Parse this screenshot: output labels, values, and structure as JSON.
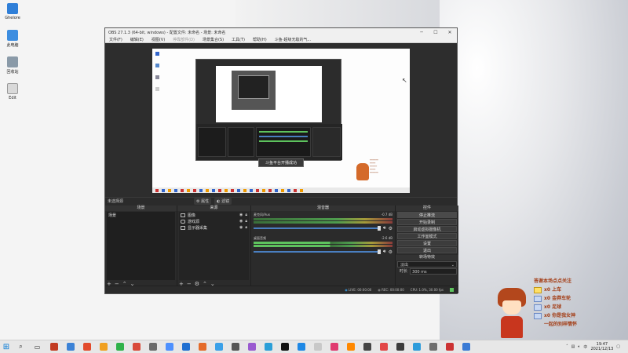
{
  "desktop": {
    "icons": [
      {
        "label": "Ghelore",
        "color": "#2f7fd8",
        "icon": "folder-icon"
      },
      {
        "label": "此电脑",
        "color": "#3c8de0",
        "icon": "computer-icon"
      },
      {
        "label": "回收站",
        "color": "#8a9aa8",
        "icon": "recycle-bin-icon"
      },
      {
        "label": "Edit",
        "color": "#d9d9d9",
        "icon": "file-icon"
      }
    ]
  },
  "obs": {
    "title": "OBS 27.1.3 (64-bit, windows) - 配置文件: 未命名 - 场景: 未命名",
    "menu": [
      "文件(F)",
      "编辑(E)",
      "视图(V)",
      "停靠部件(D)",
      "场景集合(S)",
      "工具(T)",
      "帮助(H)",
      "斗鱼-超级无敌的气..."
    ],
    "toast": "斗鱼平台开播成功",
    "scene_bar": {
      "label": "未选择源",
      "tab1": "属性",
      "tab2": "滤镜"
    },
    "docks": {
      "scenes": {
        "title": "场景",
        "items": [
          "场景"
        ]
      },
      "sources": {
        "title": "来源",
        "items": [
          {
            "label": "图像",
            "icon": "image-icon"
          },
          {
            "label": "游戏源",
            "icon": "game-icon"
          },
          {
            "label": "显示器采集",
            "icon": "monitor-icon"
          }
        ]
      },
      "mixer": {
        "title": "混音器",
        "tracks": [
          {
            "name": "麦克风/Aux",
            "db": "-0.7 dB"
          },
          {
            "name": "桌面音频",
            "db": "-2.6 dB"
          }
        ]
      },
      "controls": {
        "title": "控件",
        "buttons": [
          "停止推流",
          "开始录制",
          "启动虚拟摄像机",
          "工作室模式",
          "设置",
          "退出"
        ]
      },
      "transitions": {
        "title": "转场特效",
        "selected": "淡出",
        "duration_label": "时长",
        "duration": "300 ms"
      }
    },
    "status": {
      "live": "LIVE: 00:00:00",
      "rec": "REC: 00:00:00",
      "cpu": "CPU: 1.0%, 30.00 fps"
    }
  },
  "overlay": {
    "header": "答谢本场点点关注",
    "lines": [
      "x0 上车",
      "x0 金莽车轮",
      "x0 足球",
      "x0 你是我女神",
      "一起的别样情怀"
    ]
  },
  "taskbar": {
    "time": "19:47",
    "date": "2021/12/13",
    "icons": [
      "#c23b22",
      "#3b82d6",
      "#e24a2b",
      "#f0a020",
      "#2fb24a",
      "#d94a3a",
      "#6b6b6b",
      "#4d90fe",
      "#1f6fd1",
      "#e46b2a",
      "#3aa0e8",
      "#555555",
      "#9a5bd0",
      "#2b9fd8",
      "#111111",
      "#1e88e5",
      "#c8c8c8",
      "#e03a70",
      "#ff8800",
      "#444444",
      "#e24545",
      "#3c3c3c",
      "#2d9cdb",
      "#6e6e6e",
      "#cc3333",
      "#3a7bd5"
    ]
  }
}
